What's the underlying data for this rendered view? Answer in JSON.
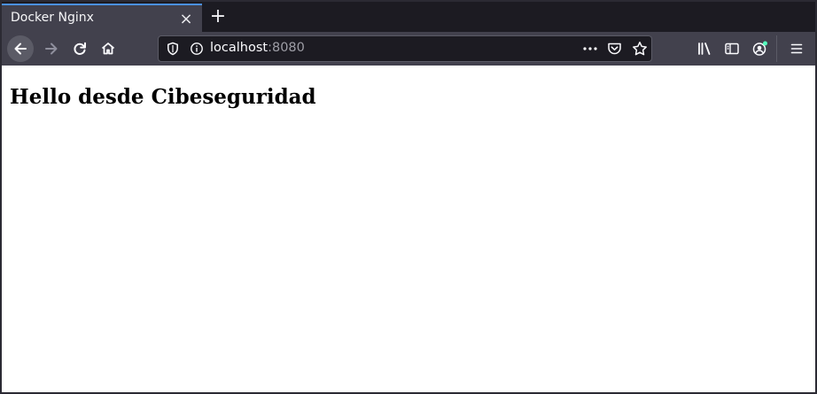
{
  "tab": {
    "title": "Docker Nginx",
    "close_glyph": "×",
    "new_tab_glyph": "+"
  },
  "navbar": {
    "icons": [
      "back-arrow-icon",
      "forward-arrow-icon",
      "reload-icon",
      "home-icon"
    ]
  },
  "urlbar": {
    "host": "localhost",
    "port": ":8080",
    "icons": [
      "shield-icon",
      "info-icon",
      "more-dots-icon",
      "pocket-icon",
      "star-icon"
    ]
  },
  "toolbar_right": {
    "icons": [
      "library-icon",
      "sidebar-icon",
      "account-icon",
      "menu-icon"
    ]
  },
  "page": {
    "heading": "Hello desde Cibeseguridad"
  },
  "colors": {
    "tabstrip_bg": "#1c1b22",
    "toolbar_bg": "#42414d",
    "tab_accent": "#4a90e2",
    "content_bg": "#ffffff",
    "account_dot": "#54ffbd"
  }
}
